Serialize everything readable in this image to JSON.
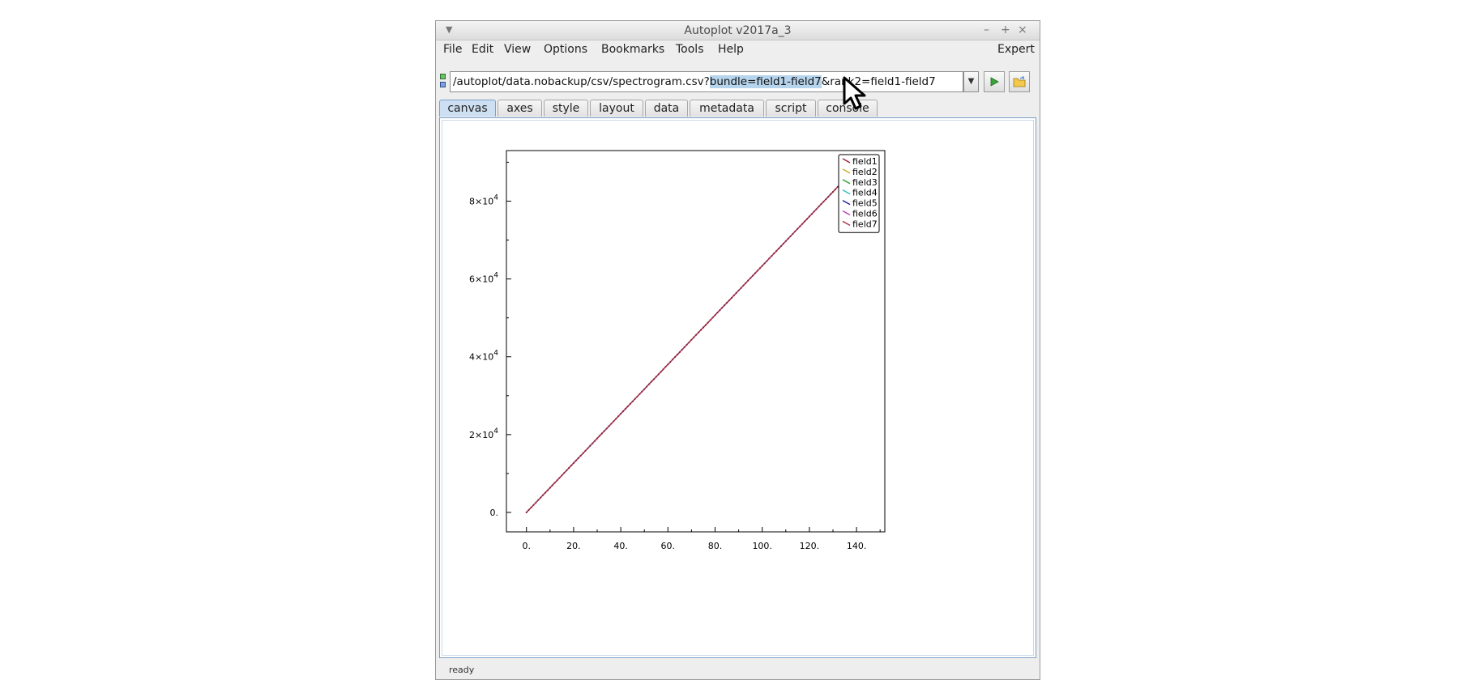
{
  "window": {
    "title": "Autoplot v2017a_3",
    "controls": [
      "–",
      "+",
      "×"
    ]
  },
  "menubar": {
    "items": [
      "File",
      "Edit",
      "View",
      "Options",
      "Bookmarks",
      "Tools",
      "Help"
    ],
    "right": "Expert"
  },
  "url_bar": {
    "prefix": "/autoplot/data.nobackup/csv/spectrogram.csv?",
    "selected": "bundle=field1-field7",
    "suffix": "&rank2=field1-field7"
  },
  "tabs": [
    "canvas",
    "axes",
    "style",
    "layout",
    "data",
    "metadata",
    "script",
    "console"
  ],
  "active_tab": "canvas",
  "status": {
    "text": "ready"
  },
  "chart_data": {
    "type": "line",
    "title": "",
    "xlabel": "",
    "ylabel": "",
    "xlim": [
      -8.5,
      152
    ],
    "ylim": [
      -5000,
      93000
    ],
    "xticks": [
      0,
      20,
      40,
      60,
      80,
      100,
      120,
      140
    ],
    "xtick_labels": [
      "0.",
      "20.",
      "40.",
      "60.",
      "80.",
      "100.",
      "120.",
      "140."
    ],
    "yticks": [
      0,
      20000,
      40000,
      60000,
      80000
    ],
    "ytick_labels": [
      {
        "mantissa": "0.",
        "exp": ""
      },
      {
        "mantissa": "2×10",
        "exp": "4"
      },
      {
        "mantissa": "4×10",
        "exp": "4"
      },
      {
        "mantissa": "6×10",
        "exp": "4"
      },
      {
        "mantissa": "8×10",
        "exp": "4"
      }
    ],
    "series": [
      {
        "name": "field1",
        "color": "#9b2335"
      },
      {
        "name": "field2",
        "color": "#c9b020"
      },
      {
        "name": "field3",
        "color": "#3ca83c"
      },
      {
        "name": "field4",
        "color": "#40c0c0"
      },
      {
        "name": "field5",
        "color": "#1f1fa8"
      },
      {
        "name": "field6",
        "color": "#c040c0"
      },
      {
        "name": "field7",
        "color": "#b0304a"
      }
    ],
    "line": {
      "x_start": 0,
      "x_end": 142,
      "y_start": 0,
      "y_end": 90000,
      "points": 143
    },
    "legend": "top-right",
    "grid": false
  }
}
